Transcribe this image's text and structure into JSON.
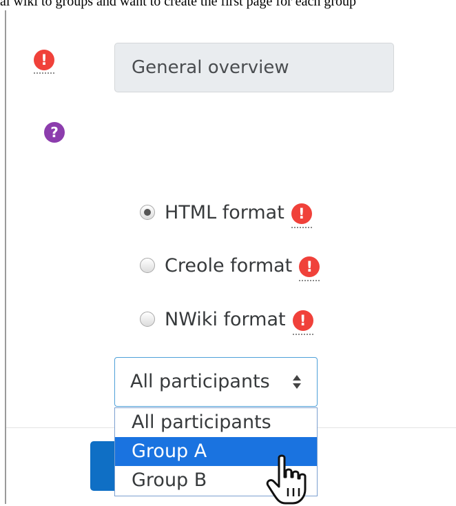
{
  "page": {
    "top_text": "al wiki to groups and want to create the first page for each group"
  },
  "page_name": {
    "value": "General overview"
  },
  "format": {
    "options": [
      {
        "label": "HTML format",
        "checked": true
      },
      {
        "label": "Creole format",
        "checked": false
      },
      {
        "label": "NWiki format",
        "checked": false
      }
    ]
  },
  "group_select": {
    "selected": "All participants",
    "options": [
      "All participants",
      "Group A",
      "Group B"
    ],
    "highlighted": "Group A"
  },
  "colors": {
    "required_icon": "#f0413a",
    "help_icon": "#8c3dad",
    "button_primary": "#0f6fc5",
    "dropdown_highlight": "#1a73e0"
  },
  "icons": {
    "required": "exclamation-circle-icon",
    "help": "question-circle-icon",
    "cursor": "hand-pointer-cursor"
  }
}
